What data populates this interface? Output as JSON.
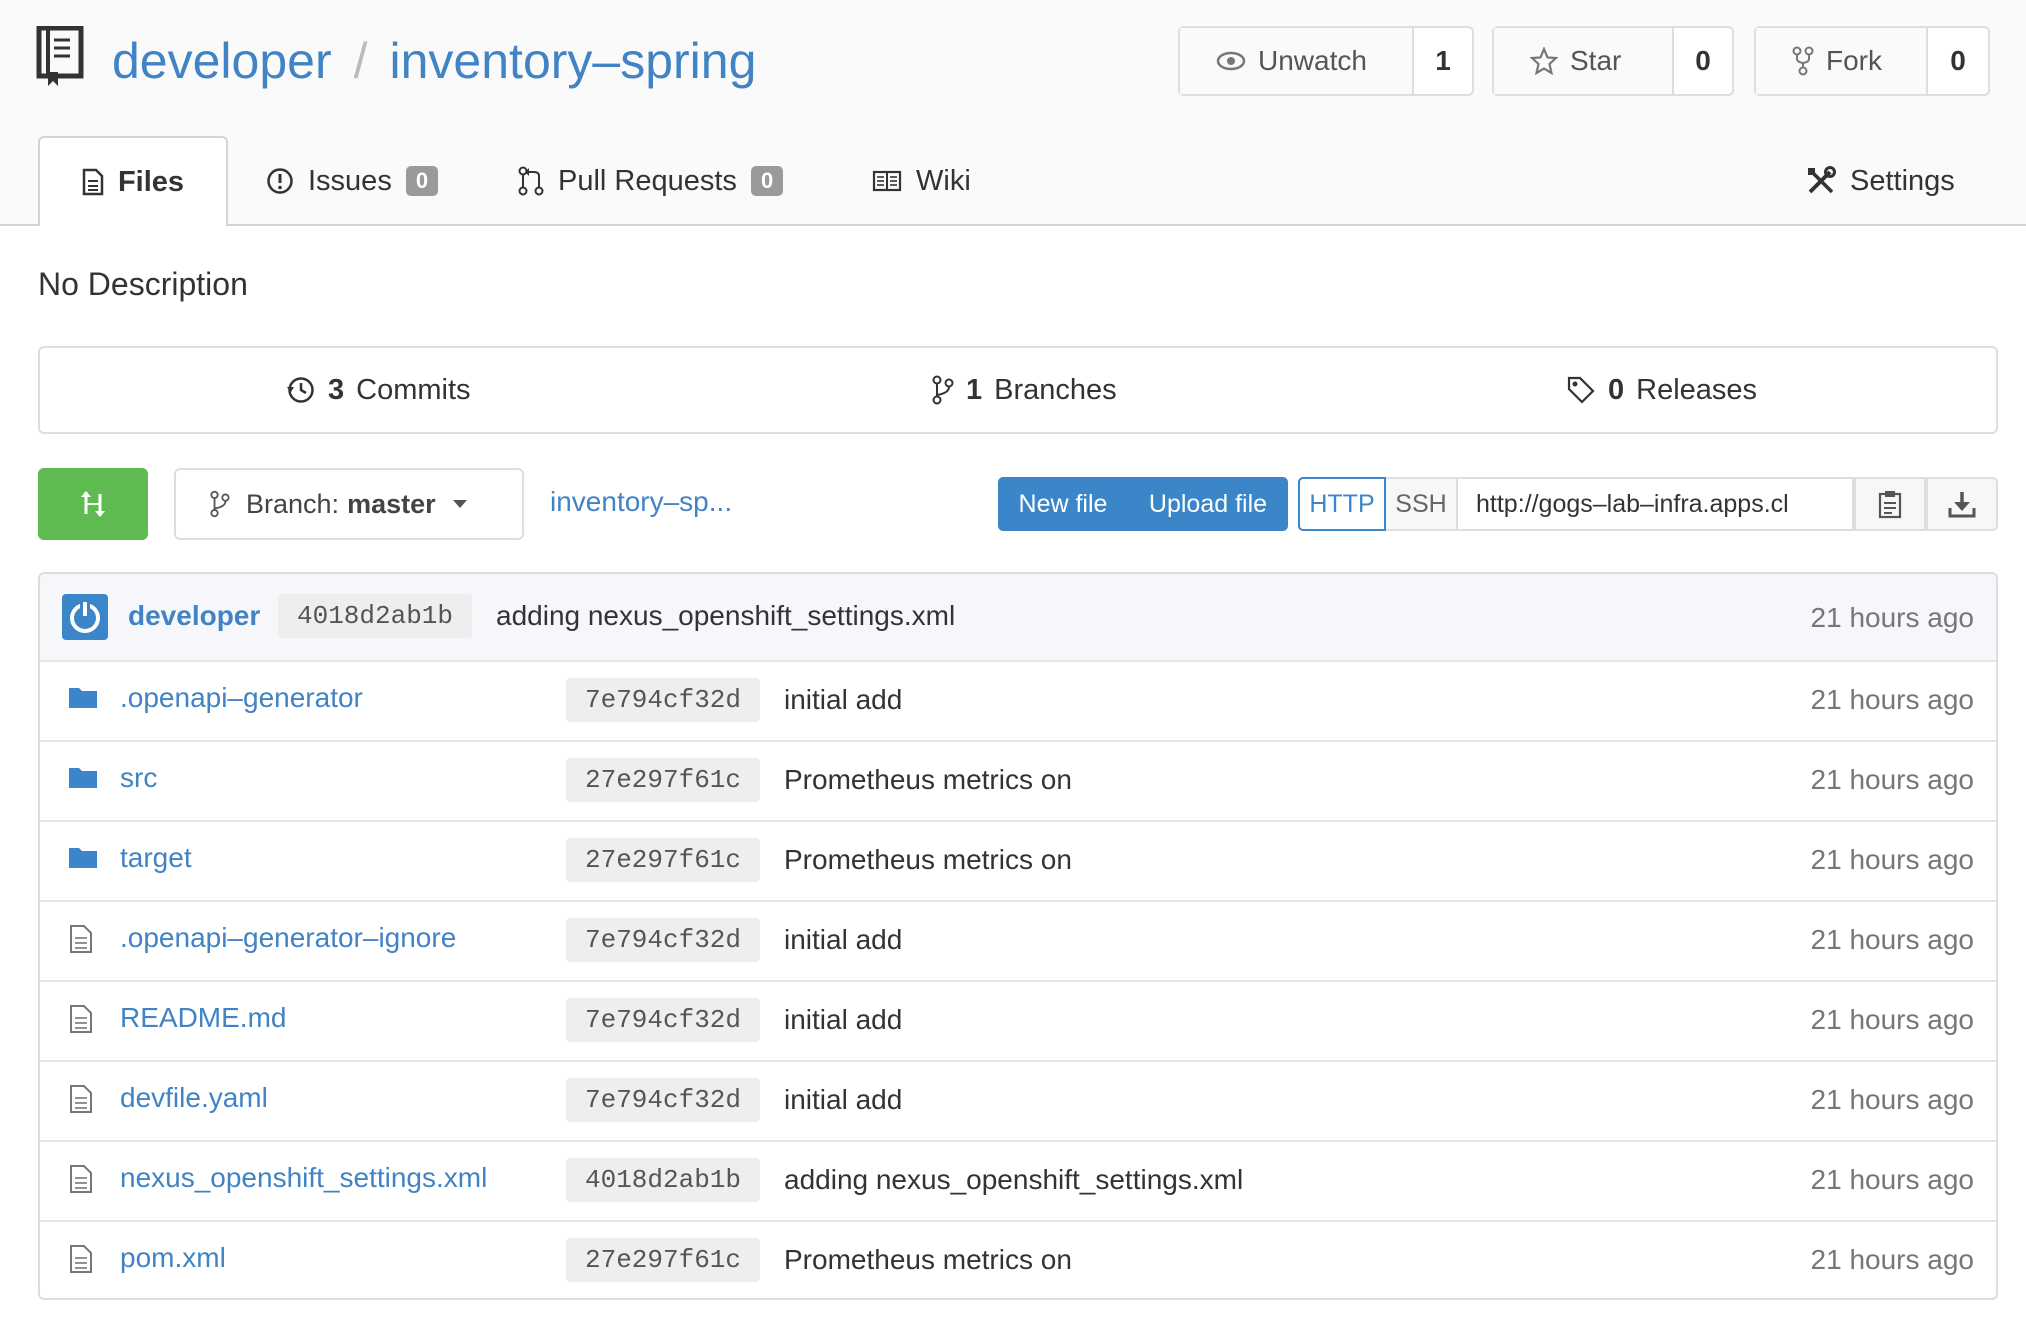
{
  "repo": {
    "owner": "developer",
    "separator": "/",
    "name": "inventory–spring"
  },
  "actions": [
    {
      "label": "Unwatch",
      "count": "1",
      "icon": "eye-icon"
    },
    {
      "label": "Star",
      "count": "0",
      "icon": "star-icon"
    },
    {
      "label": "Fork",
      "count": "0",
      "icon": "fork-icon"
    }
  ],
  "tabs": {
    "files": "Files",
    "issues": "Issues",
    "issues_count": "0",
    "pulls": "Pull Requests",
    "pulls_count": "0",
    "wiki": "Wiki",
    "settings": "Settings"
  },
  "description": "No Description",
  "stats": {
    "commits_count": "3",
    "commits_label": "Commits",
    "branches_count": "1",
    "branches_label": "Branches",
    "releases_count": "0",
    "releases_label": "Releases"
  },
  "toolbar": {
    "branch_prefix": "Branch:",
    "branch_name": "master",
    "breadcrumb": "inventory–sp...",
    "new_file": "New file",
    "upload_file": "Upload file",
    "http": "HTTP",
    "ssh": "SSH",
    "clone_url": "http://gogs–lab–infra.apps.cl"
  },
  "latest_commit": {
    "author": "developer",
    "sha": "4018d2ab1b",
    "message": "adding nexus_openshift_settings.xml",
    "age": "21 hours ago"
  },
  "files": [
    {
      "type": "dir",
      "name": ".openapi–generator",
      "sha": "7e794cf32d",
      "message": "initial add",
      "age": "21 hours ago"
    },
    {
      "type": "dir",
      "name": "src",
      "sha": "27e297f61c",
      "message": "Prometheus metrics on",
      "age": "21 hours ago"
    },
    {
      "type": "dir",
      "name": "target",
      "sha": "27e297f61c",
      "message": "Prometheus metrics on",
      "age": "21 hours ago"
    },
    {
      "type": "file",
      "name": ".openapi–generator–ignore",
      "sha": "7e794cf32d",
      "message": "initial add",
      "age": "21 hours ago"
    },
    {
      "type": "file",
      "name": "README.md",
      "sha": "7e794cf32d",
      "message": "initial add",
      "age": "21 hours ago"
    },
    {
      "type": "file",
      "name": "devfile.yaml",
      "sha": "7e794cf32d",
      "message": "initial add",
      "age": "21 hours ago"
    },
    {
      "type": "file",
      "name": "nexus_openshift_settings.xml",
      "sha": "4018d2ab1b",
      "message": "adding nexus_openshift_settings.xml",
      "age": "21 hours ago"
    },
    {
      "type": "file",
      "name": "pom.xml",
      "sha": "27e297f61c",
      "message": "Prometheus metrics on",
      "age": "21 hours ago"
    }
  ],
  "colors": {
    "link": "#4183c4",
    "primary": "#3a86c8",
    "success": "#5dbb4f",
    "badge": "#9a9a9a"
  }
}
